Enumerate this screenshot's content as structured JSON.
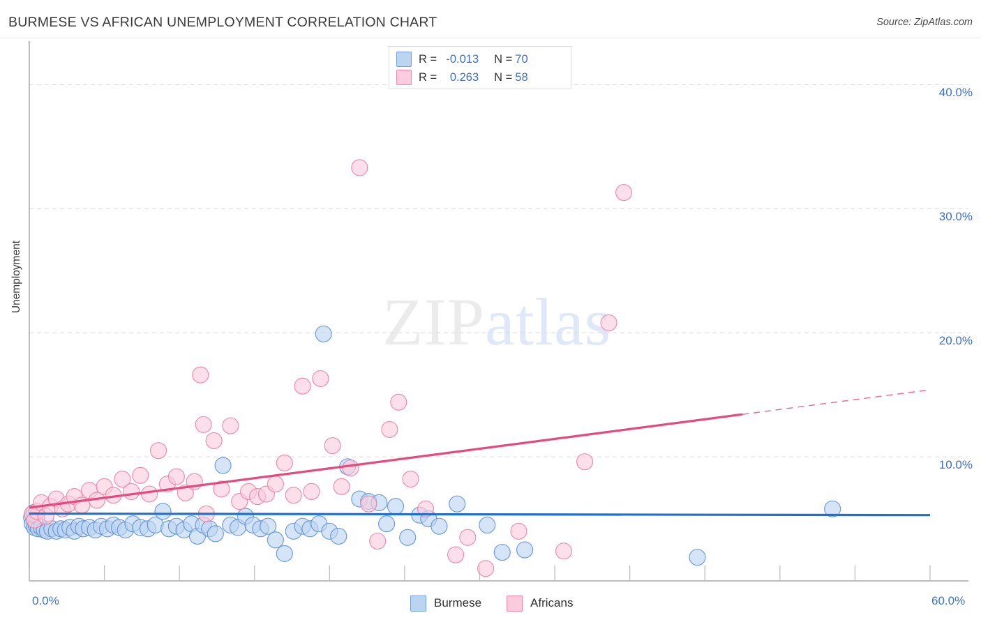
{
  "header": {
    "title": "BURMESE VS AFRICAN UNEMPLOYMENT CORRELATION CHART",
    "source": "Source: ZipAtlas.com"
  },
  "watermark": {
    "part1": "ZIP",
    "part2": "atlas"
  },
  "stats_box": {
    "rows": [
      {
        "series": "Burmese",
        "r_label": "R =",
        "r_value": "-0.013",
        "n_label": "N =",
        "n_value": "70",
        "color": "#bcd4f0"
      },
      {
        "series": "Africans",
        "r_label": "R =",
        "r_value": "0.263",
        "n_label": "N =",
        "n_value": "58",
        "color": "#fbccdb"
      }
    ]
  },
  "legend": {
    "items": [
      {
        "label": "Burmese",
        "color": "#bcd4f0",
        "border": "#6f9fd8"
      },
      {
        "label": "Africans",
        "color": "#fbccdb",
        "border": "#e98bac"
      }
    ]
  },
  "chart_data": {
    "type": "scatter",
    "title": "BURMESE VS AFRICAN UNEMPLOYMENT CORRELATION CHART",
    "xlabel": "",
    "ylabel": "Unemployment",
    "xlim": [
      0,
      60
    ],
    "ylim": [
      0,
      43.5
    ],
    "x_tick_labels": [
      "0.0%",
      "60.0%"
    ],
    "y_tick_labels": [
      "10.0%",
      "20.0%",
      "30.0%",
      "40.0%"
    ],
    "y_gridlines": [
      10,
      20,
      30,
      40
    ],
    "x_tick_step": 5,
    "grid": true,
    "legend_position": "bottom-center",
    "series": [
      {
        "name": "Burmese",
        "color": "#bcd4f0",
        "border": "#5b8fd4",
        "r": -0.013,
        "n": 70,
        "trend": {
          "x0": 0,
          "y0": 5.42,
          "x1": 60,
          "y1": 5.3,
          "color": "#1f6fd0",
          "style": "solid"
        },
        "points": [
          [
            0.15,
            5.1
          ],
          [
            0.2,
            4.6
          ],
          [
            0.3,
            5.5
          ],
          [
            0.35,
            4.3
          ],
          [
            0.45,
            4.5
          ],
          [
            0.5,
            5.2
          ],
          [
            0.6,
            4.2
          ],
          [
            0.8,
            4.3
          ],
          [
            1.0,
            4.1
          ],
          [
            1.2,
            4.0
          ],
          [
            1.5,
            4.2
          ],
          [
            1.8,
            4.0
          ],
          [
            2.1,
            4.2
          ],
          [
            2.4,
            4.1
          ],
          [
            2.7,
            4.3
          ],
          [
            3.0,
            4.0
          ],
          [
            3.3,
            4.4
          ],
          [
            3.6,
            4.2
          ],
          [
            4.0,
            4.3
          ],
          [
            4.4,
            4.1
          ],
          [
            4.8,
            4.4
          ],
          [
            5.2,
            4.2
          ],
          [
            5.6,
            4.5
          ],
          [
            6.0,
            4.3
          ],
          [
            6.4,
            4.1
          ],
          [
            6.9,
            4.6
          ],
          [
            7.4,
            4.3
          ],
          [
            7.9,
            4.2
          ],
          [
            8.4,
            4.5
          ],
          [
            8.9,
            5.6
          ],
          [
            9.3,
            4.2
          ],
          [
            9.8,
            4.4
          ],
          [
            10.3,
            4.1
          ],
          [
            10.8,
            4.6
          ],
          [
            11.2,
            3.6
          ],
          [
            11.6,
            4.5
          ],
          [
            12.0,
            4.2
          ],
          [
            12.4,
            3.8
          ],
          [
            12.9,
            9.3
          ],
          [
            13.4,
            4.5
          ],
          [
            13.9,
            4.3
          ],
          [
            14.4,
            5.2
          ],
          [
            14.9,
            4.5
          ],
          [
            15.4,
            4.2
          ],
          [
            15.9,
            4.4
          ],
          [
            16.4,
            3.3
          ],
          [
            17.0,
            2.2
          ],
          [
            17.6,
            4.0
          ],
          [
            18.2,
            4.4
          ],
          [
            18.7,
            4.2
          ],
          [
            19.3,
            4.6
          ],
          [
            19.6,
            19.9
          ],
          [
            20.0,
            4.0
          ],
          [
            20.6,
            3.6
          ],
          [
            21.2,
            9.2
          ],
          [
            22.0,
            6.6
          ],
          [
            22.6,
            6.4
          ],
          [
            23.3,
            6.3
          ],
          [
            23.8,
            4.6
          ],
          [
            24.4,
            6.0
          ],
          [
            25.2,
            3.5
          ],
          [
            26.0,
            5.3
          ],
          [
            26.6,
            5.0
          ],
          [
            27.3,
            4.4
          ],
          [
            28.5,
            6.2
          ],
          [
            30.5,
            4.5
          ],
          [
            31.5,
            2.3
          ],
          [
            33.0,
            2.5
          ],
          [
            44.5,
            1.9
          ],
          [
            53.5,
            5.8
          ]
        ]
      },
      {
        "name": "Africans",
        "color": "#fbccdb",
        "border": "#e87fa6",
        "r": 0.263,
        "n": 58,
        "trend": {
          "x0": 0,
          "y0": 5.9,
          "x1": 60,
          "y1": 15.4,
          "color": "#e44a7c",
          "style": "solid-then-dashed",
          "dash_start_x": 47.5
        },
        "points": [
          [
            0.2,
            5.4
          ],
          [
            0.35,
            4.9
          ],
          [
            0.5,
            5.6
          ],
          [
            0.8,
            6.3
          ],
          [
            1.1,
            5.2
          ],
          [
            1.4,
            6.0
          ],
          [
            1.8,
            6.6
          ],
          [
            2.2,
            5.8
          ],
          [
            2.6,
            6.2
          ],
          [
            3.0,
            6.8
          ],
          [
            3.5,
            6.1
          ],
          [
            4.0,
            7.3
          ],
          [
            4.5,
            6.5
          ],
          [
            5.0,
            7.6
          ],
          [
            5.6,
            6.9
          ],
          [
            6.2,
            8.2
          ],
          [
            6.8,
            7.2
          ],
          [
            7.4,
            8.5
          ],
          [
            8.0,
            7.0
          ],
          [
            8.6,
            10.5
          ],
          [
            9.2,
            7.8
          ],
          [
            9.8,
            8.4
          ],
          [
            10.4,
            7.1
          ],
          [
            11.0,
            8.0
          ],
          [
            11.4,
            16.6
          ],
          [
            11.6,
            12.6
          ],
          [
            11.8,
            5.4
          ],
          [
            12.3,
            11.3
          ],
          [
            12.8,
            7.4
          ],
          [
            13.4,
            12.5
          ],
          [
            14.0,
            6.4
          ],
          [
            14.6,
            7.2
          ],
          [
            15.2,
            6.8
          ],
          [
            15.8,
            7.0
          ],
          [
            16.4,
            7.8
          ],
          [
            17.0,
            9.5
          ],
          [
            17.6,
            6.9
          ],
          [
            18.2,
            15.7
          ],
          [
            18.8,
            7.2
          ],
          [
            19.4,
            16.3
          ],
          [
            20.2,
            10.9
          ],
          [
            20.8,
            7.6
          ],
          [
            21.4,
            9.1
          ],
          [
            22.0,
            33.3
          ],
          [
            22.6,
            6.2
          ],
          [
            23.2,
            3.2
          ],
          [
            24.0,
            12.2
          ],
          [
            24.6,
            14.4
          ],
          [
            25.4,
            8.2
          ],
          [
            26.4,
            5.8
          ],
          [
            28.4,
            2.1
          ],
          [
            29.2,
            3.5
          ],
          [
            30.4,
            1.0
          ],
          [
            32.6,
            4.0
          ],
          [
            35.6,
            2.4
          ],
          [
            38.6,
            20.8
          ],
          [
            39.6,
            31.3
          ],
          [
            37.0,
            9.6
          ]
        ]
      }
    ]
  },
  "axis": {
    "y_labels": [
      {
        "text": "40.0%",
        "value": 40
      },
      {
        "text": "30.0%",
        "value": 30
      },
      {
        "text": "20.0%",
        "value": 20
      },
      {
        "text": "10.0%",
        "value": 10
      }
    ],
    "x_labels": [
      {
        "text": "0.0%",
        "value": 0
      },
      {
        "text": "60.0%",
        "value": 60
      }
    ]
  }
}
